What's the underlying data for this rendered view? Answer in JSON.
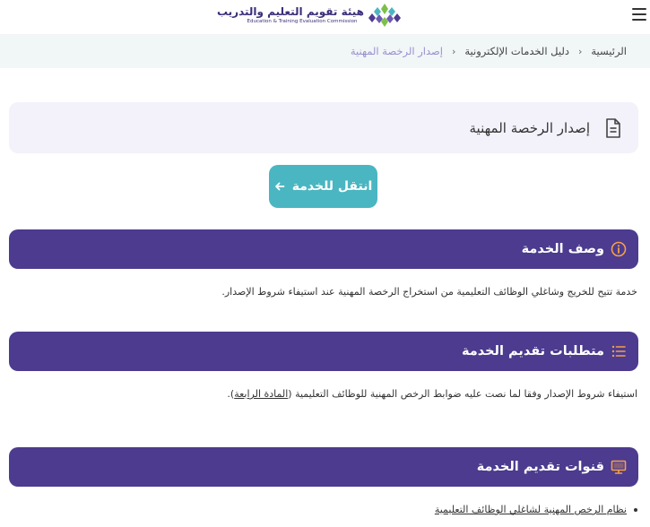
{
  "header": {
    "logo_ar": "هيئة تقويم التعليم والتدريب",
    "logo_en": "Education & Training Evaluation Commission",
    "menu_icon": "hamburger-icon"
  },
  "breadcrumb": {
    "home": "الرئيسية",
    "guide": "دليل الخدمات الإلكترونية",
    "current": "إصدار الرخصة المهنية",
    "separator": "‹"
  },
  "service": {
    "title": "إصدار الرخصة المهنية",
    "icon": "document-icon"
  },
  "go_button": {
    "label": "انتقل للخدمة",
    "icon": "arrow-left-icon"
  },
  "sections": {
    "description": {
      "title": "وصف الخدمة",
      "icon": "info-icon",
      "text": "خدمة تتيح للخريج وشاغلي الوظائف التعليمية من استخراج الرخصة المهنية عند استيفاء شروط الإصدار."
    },
    "requirements": {
      "title": "متطلبات تقديم الخدمة",
      "icon": "list-icon",
      "text_before": "استيفاء شروط الإصدار وفقا لما نصت عليه ضوابط الرخص المهنية للوظائف التعليمية (",
      "link": "المادة الرابعة",
      "text_after": ")."
    },
    "channels": {
      "title": "قنوات تقديم الخدمة",
      "icon": "monitor-icon",
      "items": [
        "نظام الرخص المهنية لشاغلي الوظائف التعليمية"
      ]
    }
  },
  "colors": {
    "primary": "#4c3b8e",
    "accent": "#4ab6c2",
    "icon_orange": "#f5a04a",
    "breadcrumb_bg": "#f1f6f7",
    "title_box_bg": "#f3f2fb"
  }
}
